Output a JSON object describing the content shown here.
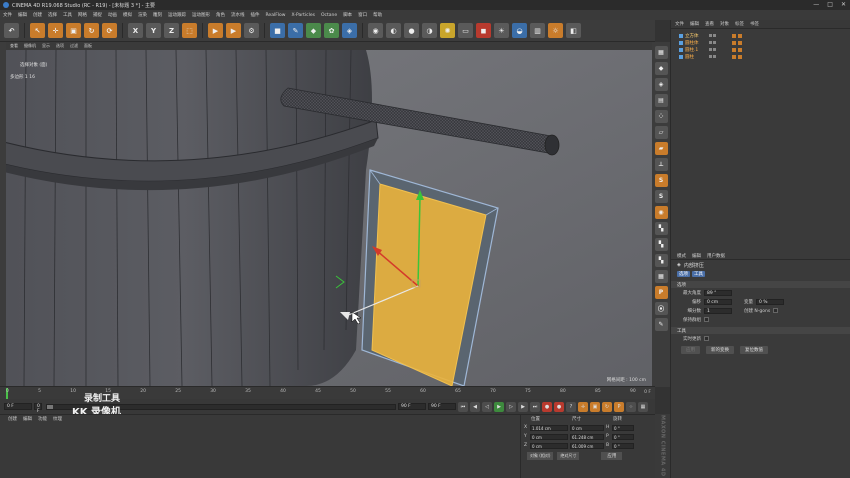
{
  "window": {
    "title": "CINEMA 4D R19.068 Studio (RC - R19) - [未标题 3 *] - 主要",
    "controls": [
      "—",
      "□",
      "✕"
    ]
  },
  "menubar": {
    "items": [
      "文件",
      "编辑",
      "创建",
      "选择",
      "工具",
      "网格",
      "捕捉",
      "动画",
      "模拟",
      "渲染",
      "雕刻",
      "运动跟踪",
      "运动图形",
      "角色",
      "流水线",
      "插件",
      "RealFlow",
      "X-Particles",
      "Octane",
      "脚本",
      "窗口",
      "帮助"
    ]
  },
  "viewport": {
    "menu": [
      "查看",
      "摄像机",
      "显示",
      "选项",
      "过滤",
      "面板"
    ],
    "label_selected": "选择对象 (面)",
    "label_count": "多边形  1   16",
    "scale": "网格间距 : 100 cm"
  },
  "objects": {
    "menu": [
      "文件",
      "编辑",
      "查看",
      "对象",
      "标签",
      "书签"
    ],
    "items": [
      {
        "name": "立方体",
        "selected": true
      },
      {
        "name": "圆柱体",
        "selected": false
      },
      {
        "name": "圆柱.1",
        "selected": false
      },
      {
        "name": "圆柱",
        "selected": false
      }
    ]
  },
  "attributes": {
    "menu": [
      "模式",
      "编辑",
      "用户数据"
    ],
    "title": "内部挤压",
    "tabs": [
      "选项",
      "工具"
    ],
    "section_options": "选项",
    "fields": {
      "max_angle_label": "最大角度",
      "max_angle_value": "89 °",
      "offset_label": "偏移",
      "offset_value": "0 cm",
      "subdiv_label": "细分数",
      "subdiv_value": "1",
      "preserve_groups_label": "保持群组",
      "variance_label": "变量",
      "variance_value": "0 %",
      "ngon_label": "创建 N-gons"
    },
    "section_tool": "工具",
    "realtime_update_label": "实时更新",
    "buttons": [
      "应用",
      "新的变换",
      "复位数值"
    ]
  },
  "timeline": {
    "ticks": [
      "0",
      "5",
      "10",
      "15",
      "20",
      "25",
      "30",
      "35",
      "40",
      "45",
      "50",
      "55",
      "60",
      "65",
      "70",
      "75",
      "80",
      "85",
      "90"
    ],
    "end_frame": "0 F"
  },
  "transport": {
    "start": "0 F",
    "current": "0 F",
    "end": "90 F",
    "end2": "90 F"
  },
  "watermark": {
    "line1": "录制工具",
    "line2": "KK 录像机"
  },
  "material": {
    "menu": [
      "创建",
      "编辑",
      "功能",
      "纹理"
    ]
  },
  "coordinates": {
    "headers": [
      "位置",
      "尺寸",
      "旋转"
    ],
    "rows": [
      {
        "axis": "X",
        "pos": "1.014 cm",
        "size": "0 cm",
        "rot_axis": "H",
        "rot": "0 °"
      },
      {
        "axis": "Y",
        "pos": "0 cm",
        "size": "61.248 cm",
        "rot_axis": "P",
        "rot": "0 °"
      },
      {
        "axis": "Z",
        "pos": "0 cm",
        "size": "61.009 cm",
        "rot_axis": "B",
        "rot": "0 °"
      }
    ],
    "mode": "对象 (相对)",
    "size_mode": "绝对尺寸",
    "apply": "应用"
  },
  "brand": "MAXON CINEMA 4D",
  "colors": {
    "accent_orange": "#c97c2b",
    "selection_yellow": "#e8a83a",
    "accent_blue": "#3b7cc9"
  }
}
